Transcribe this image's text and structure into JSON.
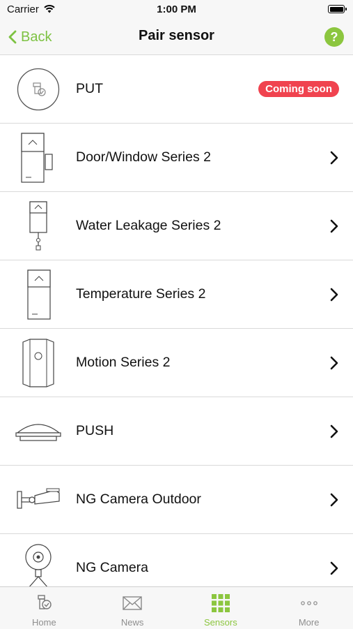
{
  "status_bar": {
    "carrier": "Carrier",
    "time": "1:00 PM"
  },
  "nav": {
    "back_label": "Back",
    "title": "Pair sensor",
    "help_label": "?"
  },
  "colors": {
    "accent": "#8cc63f",
    "badge": "#f0434f"
  },
  "sensors": [
    {
      "label": "PUT",
      "icon": "put-device-icon",
      "badge": "Coming soon"
    },
    {
      "label": "Door/Window Series 2",
      "icon": "door-window-sensor-icon"
    },
    {
      "label": "Water Leakage Series 2",
      "icon": "water-leakage-sensor-icon"
    },
    {
      "label": "Temperature Series 2",
      "icon": "temperature-sensor-icon"
    },
    {
      "label": "Motion Series 2",
      "icon": "motion-sensor-icon"
    },
    {
      "label": "PUSH",
      "icon": "push-button-icon"
    },
    {
      "label": "NG Camera Outdoor",
      "icon": "outdoor-camera-icon"
    },
    {
      "label": "NG Camera",
      "icon": "indoor-camera-icon"
    }
  ],
  "tabs": [
    {
      "label": "Home",
      "icon": "home-icon",
      "active": false
    },
    {
      "label": "News",
      "icon": "news-icon",
      "active": false
    },
    {
      "label": "Sensors",
      "icon": "sensors-grid-icon",
      "active": true
    },
    {
      "label": "More",
      "icon": "more-icon",
      "active": false
    }
  ]
}
